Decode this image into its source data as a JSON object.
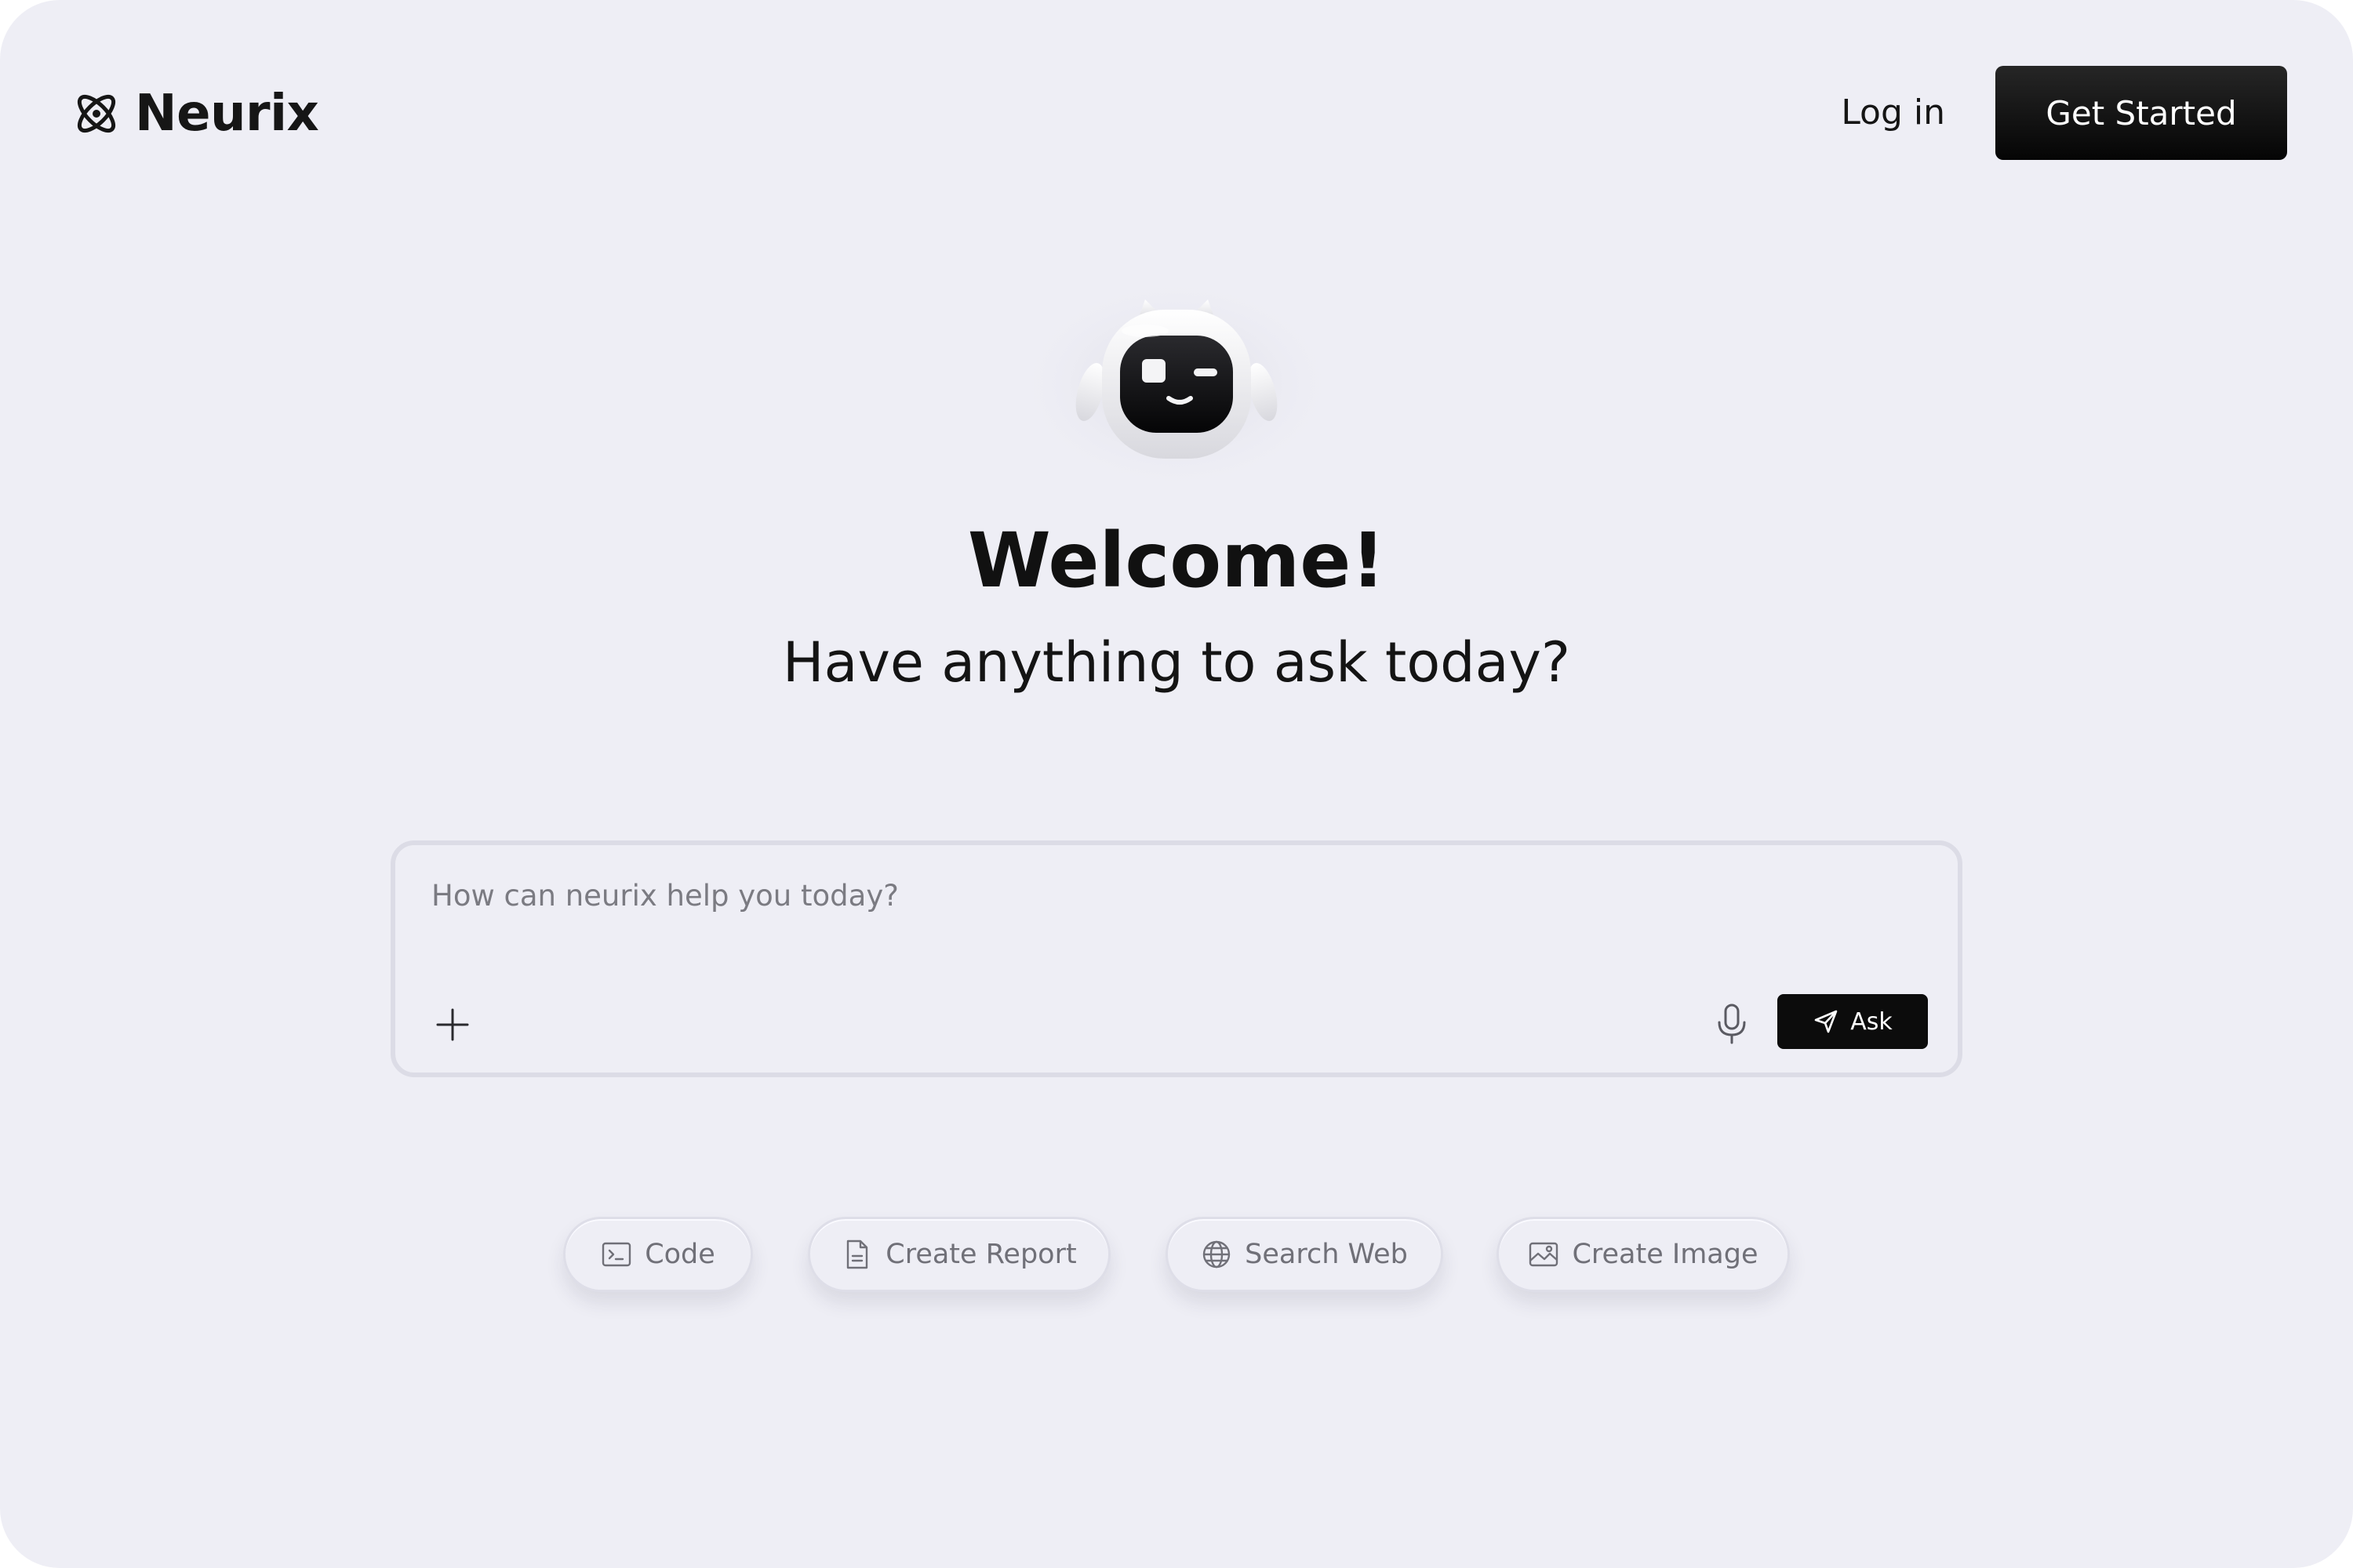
{
  "header": {
    "brand_name": "Neurix",
    "brand_icon": "atom-logo-icon",
    "login_label": "Log in",
    "cta_label": "Get Started"
  },
  "hero": {
    "mascot": "robot-mascot",
    "title": "Welcome!",
    "subtitle": "Have anything to ask today?"
  },
  "prompt": {
    "placeholder": "How can neurix help you today?",
    "value": "",
    "add_icon": "plus-icon",
    "mic_icon": "microphone-icon",
    "ask_icon": "send-icon",
    "ask_label": "Ask"
  },
  "chips": [
    {
      "label": "Code",
      "icon": "terminal-icon"
    },
    {
      "label": "Create Report",
      "icon": "document-icon"
    },
    {
      "label": "Search Web",
      "icon": "globe-icon"
    },
    {
      "label": "Create Image",
      "icon": "image-icon"
    }
  ],
  "colors": {
    "background": "#eeeef5",
    "primary_button": "#0c0c0c",
    "text": "#111111",
    "muted_text": "#707078"
  }
}
